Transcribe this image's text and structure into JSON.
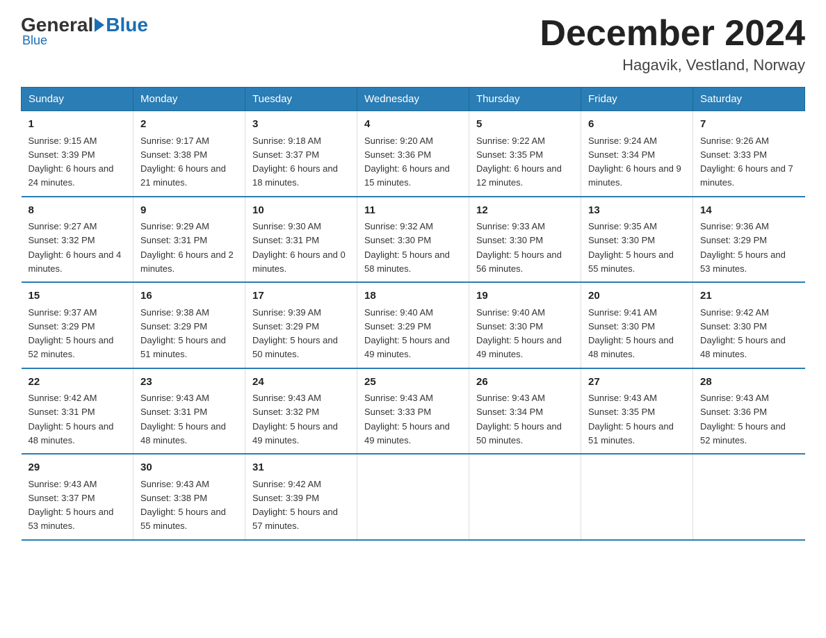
{
  "logo": {
    "general": "General",
    "arrow": "",
    "blue": "Blue"
  },
  "title": "December 2024",
  "location": "Hagavik, Vestland, Norway",
  "days_of_week": [
    "Sunday",
    "Monday",
    "Tuesday",
    "Wednesday",
    "Thursday",
    "Friday",
    "Saturday"
  ],
  "weeks": [
    [
      {
        "num": "1",
        "sunrise": "9:15 AM",
        "sunset": "3:39 PM",
        "daylight": "6 hours and 24 minutes."
      },
      {
        "num": "2",
        "sunrise": "9:17 AM",
        "sunset": "3:38 PM",
        "daylight": "6 hours and 21 minutes."
      },
      {
        "num": "3",
        "sunrise": "9:18 AM",
        "sunset": "3:37 PM",
        "daylight": "6 hours and 18 minutes."
      },
      {
        "num": "4",
        "sunrise": "9:20 AM",
        "sunset": "3:36 PM",
        "daylight": "6 hours and 15 minutes."
      },
      {
        "num": "5",
        "sunrise": "9:22 AM",
        "sunset": "3:35 PM",
        "daylight": "6 hours and 12 minutes."
      },
      {
        "num": "6",
        "sunrise": "9:24 AM",
        "sunset": "3:34 PM",
        "daylight": "6 hours and 9 minutes."
      },
      {
        "num": "7",
        "sunrise": "9:26 AM",
        "sunset": "3:33 PM",
        "daylight": "6 hours and 7 minutes."
      }
    ],
    [
      {
        "num": "8",
        "sunrise": "9:27 AM",
        "sunset": "3:32 PM",
        "daylight": "6 hours and 4 minutes."
      },
      {
        "num": "9",
        "sunrise": "9:29 AM",
        "sunset": "3:31 PM",
        "daylight": "6 hours and 2 minutes."
      },
      {
        "num": "10",
        "sunrise": "9:30 AM",
        "sunset": "3:31 PM",
        "daylight": "6 hours and 0 minutes."
      },
      {
        "num": "11",
        "sunrise": "9:32 AM",
        "sunset": "3:30 PM",
        "daylight": "5 hours and 58 minutes."
      },
      {
        "num": "12",
        "sunrise": "9:33 AM",
        "sunset": "3:30 PM",
        "daylight": "5 hours and 56 minutes."
      },
      {
        "num": "13",
        "sunrise": "9:35 AM",
        "sunset": "3:30 PM",
        "daylight": "5 hours and 55 minutes."
      },
      {
        "num": "14",
        "sunrise": "9:36 AM",
        "sunset": "3:29 PM",
        "daylight": "5 hours and 53 minutes."
      }
    ],
    [
      {
        "num": "15",
        "sunrise": "9:37 AM",
        "sunset": "3:29 PM",
        "daylight": "5 hours and 52 minutes."
      },
      {
        "num": "16",
        "sunrise": "9:38 AM",
        "sunset": "3:29 PM",
        "daylight": "5 hours and 51 minutes."
      },
      {
        "num": "17",
        "sunrise": "9:39 AM",
        "sunset": "3:29 PM",
        "daylight": "5 hours and 50 minutes."
      },
      {
        "num": "18",
        "sunrise": "9:40 AM",
        "sunset": "3:29 PM",
        "daylight": "5 hours and 49 minutes."
      },
      {
        "num": "19",
        "sunrise": "9:40 AM",
        "sunset": "3:30 PM",
        "daylight": "5 hours and 49 minutes."
      },
      {
        "num": "20",
        "sunrise": "9:41 AM",
        "sunset": "3:30 PM",
        "daylight": "5 hours and 48 minutes."
      },
      {
        "num": "21",
        "sunrise": "9:42 AM",
        "sunset": "3:30 PM",
        "daylight": "5 hours and 48 minutes."
      }
    ],
    [
      {
        "num": "22",
        "sunrise": "9:42 AM",
        "sunset": "3:31 PM",
        "daylight": "5 hours and 48 minutes."
      },
      {
        "num": "23",
        "sunrise": "9:43 AM",
        "sunset": "3:31 PM",
        "daylight": "5 hours and 48 minutes."
      },
      {
        "num": "24",
        "sunrise": "9:43 AM",
        "sunset": "3:32 PM",
        "daylight": "5 hours and 49 minutes."
      },
      {
        "num": "25",
        "sunrise": "9:43 AM",
        "sunset": "3:33 PM",
        "daylight": "5 hours and 49 minutes."
      },
      {
        "num": "26",
        "sunrise": "9:43 AM",
        "sunset": "3:34 PM",
        "daylight": "5 hours and 50 minutes."
      },
      {
        "num": "27",
        "sunrise": "9:43 AM",
        "sunset": "3:35 PM",
        "daylight": "5 hours and 51 minutes."
      },
      {
        "num": "28",
        "sunrise": "9:43 AM",
        "sunset": "3:36 PM",
        "daylight": "5 hours and 52 minutes."
      }
    ],
    [
      {
        "num": "29",
        "sunrise": "9:43 AM",
        "sunset": "3:37 PM",
        "daylight": "5 hours and 53 minutes."
      },
      {
        "num": "30",
        "sunrise": "9:43 AM",
        "sunset": "3:38 PM",
        "daylight": "5 hours and 55 minutes."
      },
      {
        "num": "31",
        "sunrise": "9:42 AM",
        "sunset": "3:39 PM",
        "daylight": "5 hours and 57 minutes."
      },
      null,
      null,
      null,
      null
    ]
  ],
  "labels": {
    "sunrise": "Sunrise:",
    "sunset": "Sunset:",
    "daylight": "Daylight:"
  }
}
